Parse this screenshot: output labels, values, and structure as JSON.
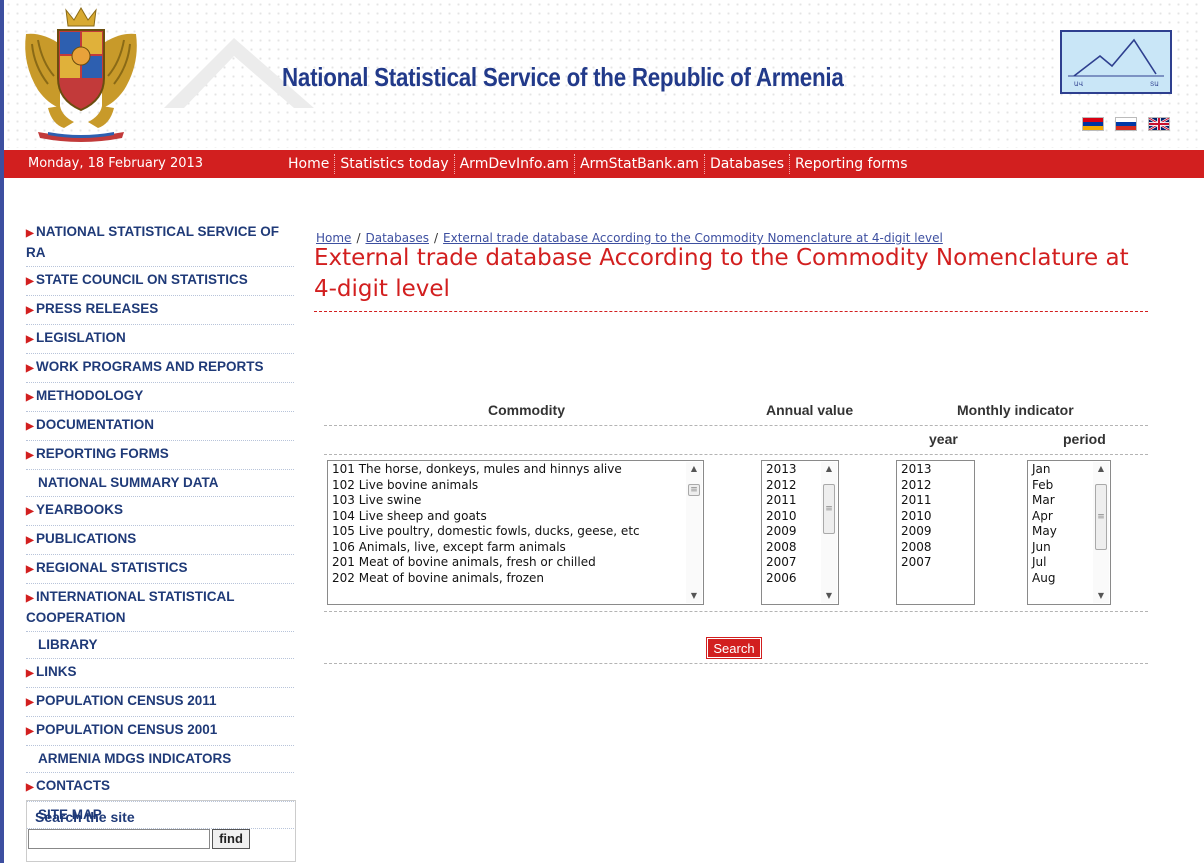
{
  "header": {
    "site_title": "National Statistical Service of the Republic of Armenia",
    "logo_icon": "armenian-coat-of-arms-icon",
    "stat_logo_icon": "nss-logo-icon",
    "languages": [
      "Armenian",
      "Russian",
      "English"
    ]
  },
  "navbar": {
    "date": "Monday, 18 February 2013",
    "links": [
      "Home",
      "Statistics today",
      "ArmDevInfo.am",
      "ArmStatBank.am",
      "Databases",
      "Reporting forms"
    ],
    "color": "#d21f1f"
  },
  "sidebar": {
    "items": [
      {
        "label": "NATIONAL STATISTICAL SERVICE OF RA",
        "arrow": true
      },
      {
        "label": "STATE COUNCIL ON STATISTICS",
        "arrow": true
      },
      {
        "label": "PRESS RELEASES",
        "arrow": true
      },
      {
        "label": "LEGISLATION",
        "arrow": true
      },
      {
        "label": "WORK PROGRAMS AND REPORTS",
        "arrow": true
      },
      {
        "label": "METHODOLOGY",
        "arrow": true
      },
      {
        "label": "DOCUMENTATION",
        "arrow": true
      },
      {
        "label": "REPORTING FORMS",
        "arrow": true
      },
      {
        "label": "NATIONAL SUMMARY DATA",
        "arrow": false
      },
      {
        "label": "YEARBOOKS",
        "arrow": true
      },
      {
        "label": "PUBLICATIONS",
        "arrow": true
      },
      {
        "label": "REGIONAL STATISTICS",
        "arrow": true
      },
      {
        "label": "INTERNATIONAL STATISTICAL COOPERATION",
        "arrow": true
      },
      {
        "label": "LIBRARY",
        "arrow": false
      },
      {
        "label": "LINKS",
        "arrow": true
      },
      {
        "label": "POPULATION CENSUS 2011",
        "arrow": true
      },
      {
        "label": "POPULATION CENSUS 2001",
        "arrow": true
      },
      {
        "label": "ARMENIA MDGS INDICATORS",
        "arrow": false
      },
      {
        "label": "CONTACTS",
        "arrow": true
      },
      {
        "label": "SITE MAP",
        "arrow": false
      }
    ],
    "search": {
      "label": "Search the site",
      "value": "",
      "button": "find"
    }
  },
  "main": {
    "breadcrumb": [
      "Home",
      "Databases",
      "External trade database According to the Commodity Nomenclature at 4-digit level"
    ],
    "title": "External trade database According to the Commodity Nomenclature at 4-digit level",
    "columns": {
      "commodity": "Commodity",
      "annual_value": "Annual value",
      "monthly_indicator": "Monthly indicator",
      "year": "year",
      "period": "period"
    },
    "commodity_options": [
      "101 The horse, donkeys, mules and hinnys alive",
      "102 Live bovine animals",
      "103 Live swine",
      "104 Live sheep and goats",
      "105 Live poultry, domestic fowls, ducks, geese, etc",
      "106 Animals, live, except farm animals",
      "201 Meat of bovine animals, fresh or chilled",
      "202 Meat of bovine animals, frozen"
    ],
    "annual_years": [
      "2013",
      "2012",
      "2011",
      "2010",
      "2009",
      "2008",
      "2007",
      "2006"
    ],
    "monthly_years": [
      "2013",
      "2012",
      "2011",
      "2010",
      "2009",
      "2008",
      "2007"
    ],
    "periods": [
      "Jan",
      "Feb",
      "Mar",
      "Apr",
      "May",
      "Jun",
      "Jul",
      "Aug"
    ],
    "search_button": "Search"
  }
}
